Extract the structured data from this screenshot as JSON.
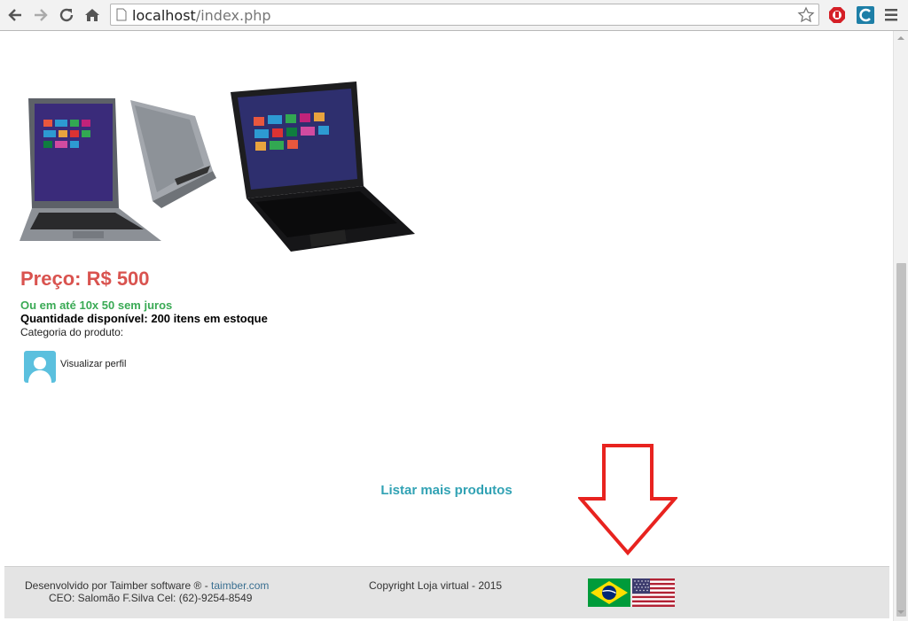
{
  "browser": {
    "url_host": "localhost",
    "url_path": "/index.php"
  },
  "product": {
    "price": "Preço: R$ 500",
    "installments": "Ou em até 10x 50 sem juros",
    "quantity": "Quantidade disponível: 200 itens em estoque",
    "category": "Categoria do produto:",
    "profile_link": "Visualizar perfil"
  },
  "list_more": "Listar mais produtos",
  "footer": {
    "dev_prefix": "Desenvolvido por Taimber software ® - ",
    "dev_link": "taimber.com",
    "ceo": "CEO: Salomão F.Silva Cel: (62)-9254-8549",
    "copyright": "Copyright Loja virtual - 2015"
  },
  "colors": {
    "price": "#d9534f",
    "installments": "#3aaa55",
    "link": "#31a2b4",
    "arrow": "#e8231f"
  },
  "icons": [
    "back-icon",
    "forward-icon",
    "reload-icon",
    "home-icon",
    "page-icon",
    "star-icon",
    "adblock-icon",
    "extension-icon",
    "menu-icon",
    "user-icon",
    "brazil-flag-icon",
    "usa-flag-icon"
  ]
}
